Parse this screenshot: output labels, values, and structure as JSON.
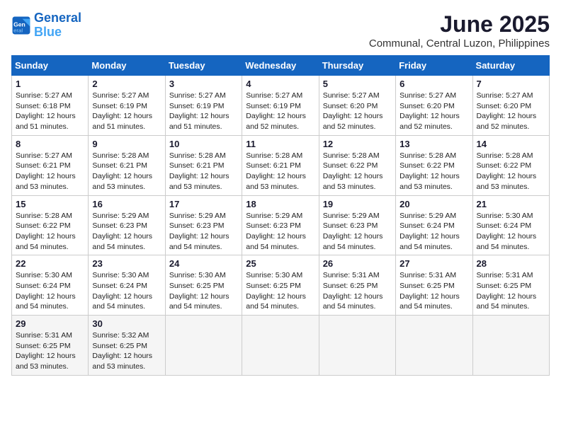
{
  "logo": {
    "line1": "General",
    "line2": "Blue"
  },
  "title": "June 2025",
  "subtitle": "Communal, Central Luzon, Philippines",
  "weekdays": [
    "Sunday",
    "Monday",
    "Tuesday",
    "Wednesday",
    "Thursday",
    "Friday",
    "Saturday"
  ],
  "days": [
    {
      "date": 1,
      "sunrise": "5:27 AM",
      "sunset": "6:18 PM",
      "daylight": "12 hours and 51 minutes."
    },
    {
      "date": 2,
      "sunrise": "5:27 AM",
      "sunset": "6:19 PM",
      "daylight": "12 hours and 51 minutes."
    },
    {
      "date": 3,
      "sunrise": "5:27 AM",
      "sunset": "6:19 PM",
      "daylight": "12 hours and 51 minutes."
    },
    {
      "date": 4,
      "sunrise": "5:27 AM",
      "sunset": "6:19 PM",
      "daylight": "12 hours and 52 minutes."
    },
    {
      "date": 5,
      "sunrise": "5:27 AM",
      "sunset": "6:20 PM",
      "daylight": "12 hours and 52 minutes."
    },
    {
      "date": 6,
      "sunrise": "5:27 AM",
      "sunset": "6:20 PM",
      "daylight": "12 hours and 52 minutes."
    },
    {
      "date": 7,
      "sunrise": "5:27 AM",
      "sunset": "6:20 PM",
      "daylight": "12 hours and 52 minutes."
    },
    {
      "date": 8,
      "sunrise": "5:27 AM",
      "sunset": "6:21 PM",
      "daylight": "12 hours and 53 minutes."
    },
    {
      "date": 9,
      "sunrise": "5:28 AM",
      "sunset": "6:21 PM",
      "daylight": "12 hours and 53 minutes."
    },
    {
      "date": 10,
      "sunrise": "5:28 AM",
      "sunset": "6:21 PM",
      "daylight": "12 hours and 53 minutes."
    },
    {
      "date": 11,
      "sunrise": "5:28 AM",
      "sunset": "6:21 PM",
      "daylight": "12 hours and 53 minutes."
    },
    {
      "date": 12,
      "sunrise": "5:28 AM",
      "sunset": "6:22 PM",
      "daylight": "12 hours and 53 minutes."
    },
    {
      "date": 13,
      "sunrise": "5:28 AM",
      "sunset": "6:22 PM",
      "daylight": "12 hours and 53 minutes."
    },
    {
      "date": 14,
      "sunrise": "5:28 AM",
      "sunset": "6:22 PM",
      "daylight": "12 hours and 53 minutes."
    },
    {
      "date": 15,
      "sunrise": "5:28 AM",
      "sunset": "6:22 PM",
      "daylight": "12 hours and 54 minutes."
    },
    {
      "date": 16,
      "sunrise": "5:29 AM",
      "sunset": "6:23 PM",
      "daylight": "12 hours and 54 minutes."
    },
    {
      "date": 17,
      "sunrise": "5:29 AM",
      "sunset": "6:23 PM",
      "daylight": "12 hours and 54 minutes."
    },
    {
      "date": 18,
      "sunrise": "5:29 AM",
      "sunset": "6:23 PM",
      "daylight": "12 hours and 54 minutes."
    },
    {
      "date": 19,
      "sunrise": "5:29 AM",
      "sunset": "6:23 PM",
      "daylight": "12 hours and 54 minutes."
    },
    {
      "date": 20,
      "sunrise": "5:29 AM",
      "sunset": "6:24 PM",
      "daylight": "12 hours and 54 minutes."
    },
    {
      "date": 21,
      "sunrise": "5:30 AM",
      "sunset": "6:24 PM",
      "daylight": "12 hours and 54 minutes."
    },
    {
      "date": 22,
      "sunrise": "5:30 AM",
      "sunset": "6:24 PM",
      "daylight": "12 hours and 54 minutes."
    },
    {
      "date": 23,
      "sunrise": "5:30 AM",
      "sunset": "6:24 PM",
      "daylight": "12 hours and 54 minutes."
    },
    {
      "date": 24,
      "sunrise": "5:30 AM",
      "sunset": "6:25 PM",
      "daylight": "12 hours and 54 minutes."
    },
    {
      "date": 25,
      "sunrise": "5:30 AM",
      "sunset": "6:25 PM",
      "daylight": "12 hours and 54 minutes."
    },
    {
      "date": 26,
      "sunrise": "5:31 AM",
      "sunset": "6:25 PM",
      "daylight": "12 hours and 54 minutes."
    },
    {
      "date": 27,
      "sunrise": "5:31 AM",
      "sunset": "6:25 PM",
      "daylight": "12 hours and 54 minutes."
    },
    {
      "date": 28,
      "sunrise": "5:31 AM",
      "sunset": "6:25 PM",
      "daylight": "12 hours and 54 minutes."
    },
    {
      "date": 29,
      "sunrise": "5:31 AM",
      "sunset": "6:25 PM",
      "daylight": "12 hours and 53 minutes."
    },
    {
      "date": 30,
      "sunrise": "5:32 AM",
      "sunset": "6:25 PM",
      "daylight": "12 hours and 53 minutes."
    }
  ],
  "labels": {
    "sunrise": "Sunrise:",
    "sunset": "Sunset:",
    "daylight": "Daylight:"
  }
}
